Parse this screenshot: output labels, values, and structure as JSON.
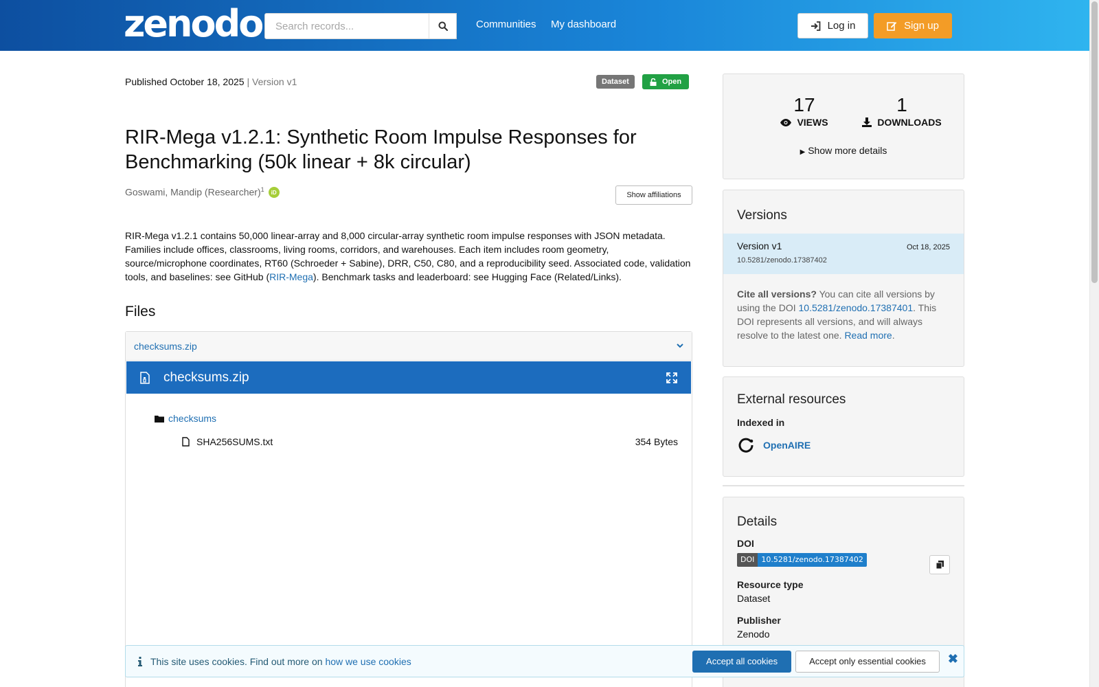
{
  "header": {
    "logo": "zenodo",
    "search_placeholder": "Search records...",
    "nav": [
      "Communities",
      "My dashboard"
    ],
    "login_label": "Log in",
    "signup_label": "Sign up"
  },
  "record": {
    "published_label": "Published October 18, 2025",
    "separator": "|",
    "version_label": "Version v1",
    "resource_badge": "Dataset",
    "access_badge": "Open",
    "title": "RIR-Mega v1.2.1: Synthetic Room Impulse Responses for Benchmarking (50k linear + 8k circular)",
    "creator": "Goswami, Mandip (Researcher)",
    "creator_sup": "1",
    "orcid_label": "iD",
    "affiliations_button": "Show affiliations",
    "description_before_link": "RIR-Mega v1.2.1 contains 50,000 linear-array and 8,000 circular-array synthetic room impulse responses with JSON metadata. Families include offices, classrooms, living rooms, corridors, and warehouses. Each item includes room geometry, source/microphone coordinates, RT60 (Schroeder + Sabine), DRR, C50, C80, and a reproducibility seed. Associated code, validation tools, and baselines: see GitHub (",
    "description_link": "RIR-Mega",
    "description_after_link": "). Benchmark tasks and leaderboard: see Hugging Face (Related/Links)."
  },
  "files": {
    "heading": "Files",
    "accordion_label": "checksums.zip",
    "preview_name": "checksums.zip",
    "folder": "checksums",
    "file_name": "SHA256SUMS.txt",
    "file_size": "354 Bytes"
  },
  "stats": {
    "views": "17",
    "views_label": "VIEWS",
    "downloads": "1",
    "downloads_label": "DOWNLOADS",
    "more_details": "Show more details"
  },
  "versions": {
    "heading": "Versions",
    "current_name": "Version v1",
    "current_date": "Oct 18, 2025",
    "current_doi": "10.5281/zenodo.17387402",
    "cite_bold": "Cite all versions?",
    "cite_text_1": " You can cite all versions by using the DOI ",
    "cite_doi": "10.5281/zenodo.17387401",
    "cite_text_2": ". This DOI represents all versions, and will always resolve to the latest one. ",
    "read_more": "Read more",
    "cite_end": "."
  },
  "external": {
    "heading": "External resources",
    "indexed_in": "Indexed in",
    "service": "OpenAIRE"
  },
  "details": {
    "heading": "Details",
    "doi_label": "DOI",
    "doi_key": "DOI",
    "doi_value": "10.5281/zenodo.17387402",
    "resource_type_label": "Resource type",
    "resource_type": "Dataset",
    "publisher_label": "Publisher",
    "publisher": "Zenodo"
  },
  "cookie": {
    "text": "This site uses cookies. Find out more on ",
    "link": "how we use cookies",
    "accept_all": "Accept all cookies",
    "accept_essential": "Accept only essential cookies"
  },
  "colors": {
    "header_gradient_start": "#0d4fa0",
    "header_gradient_end": "#2fb4ef",
    "signup": "#f39c26",
    "open_badge": "#21a144",
    "link": "#1f6fb2",
    "preview_bar": "#1c6cbe"
  }
}
